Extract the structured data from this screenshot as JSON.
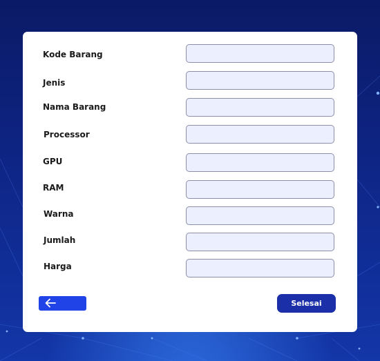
{
  "form": {
    "fields": [
      {
        "label": "Kode Barang",
        "value": "",
        "placeholder": ""
      },
      {
        "label": "Jenis",
        "value": "",
        "placeholder": ""
      },
      {
        "label": "Nama Barang",
        "value": "",
        "placeholder": ""
      },
      {
        "label": "Processor",
        "value": "",
        "placeholder": ""
      },
      {
        "label": "GPU",
        "value": "",
        "placeholder": ""
      },
      {
        "label": "RAM",
        "value": "",
        "placeholder": ""
      },
      {
        "label": "Warna",
        "value": "",
        "placeholder": ""
      },
      {
        "label": "Jumlah",
        "value": "",
        "placeholder": ""
      },
      {
        "label": "Harga",
        "value": "",
        "placeholder": ""
      }
    ]
  },
  "actions": {
    "back_icon": "arrow-left-icon",
    "submit_label": "Selesai"
  },
  "colors": {
    "background": "#0e2585",
    "field_fill": "#eceffd",
    "back_button": "#1f43e6",
    "submit_button": "#1b2fa8"
  }
}
